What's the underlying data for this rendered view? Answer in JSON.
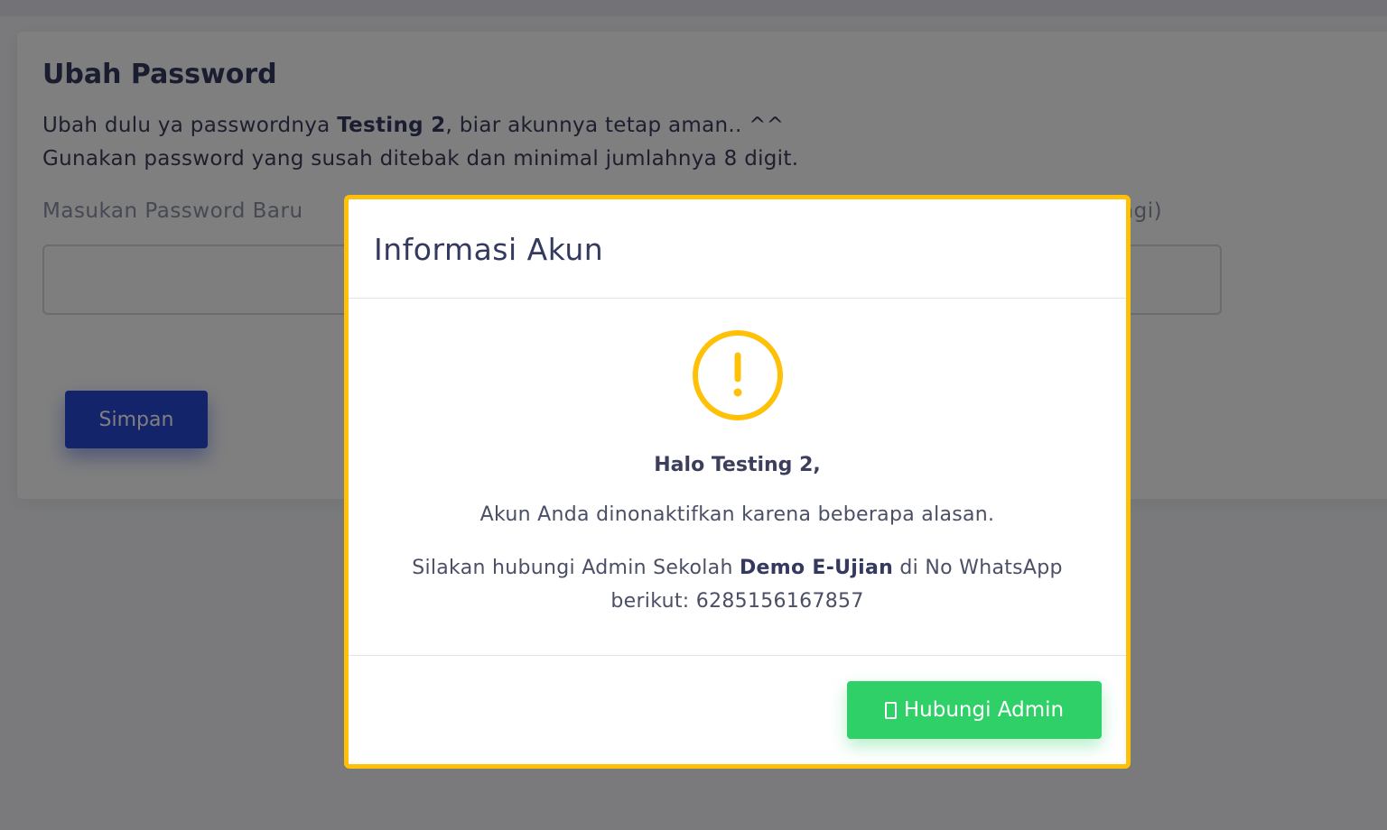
{
  "page": {
    "title": "Ubah Password",
    "desc_line1_pre": "Ubah dulu ya passwordnya ",
    "desc_line1_name": "Testing 2",
    "desc_line1_post": ", biar akunnya tetap aman.. ^^",
    "desc_line2": "Gunakan password yang susah ditebak dan minimal jumlahnya 8 digit.",
    "new_password_label": "Masukan Password Baru",
    "confirm_label_tail": "agi)",
    "save_label": "Simpan"
  },
  "modal": {
    "title": "Informasi Akun",
    "icon": "exclamation-circle-icon",
    "greeting": "Halo Testing 2,",
    "message1": "Akun Anda dinonaktifkan karena beberapa alasan.",
    "message2_pre": "Silakan hubungi Admin Sekolah ",
    "school_name": "Demo E-Ujian",
    "message2_mid": " di No WhatsApp berikut: ",
    "phone": "6285156167857",
    "button_label": "Hubungi Admin",
    "button_icon": "whatsapp-icon"
  },
  "colors": {
    "warning": "#ffc107",
    "primary": "#2849d6",
    "success": "#2ed067"
  }
}
